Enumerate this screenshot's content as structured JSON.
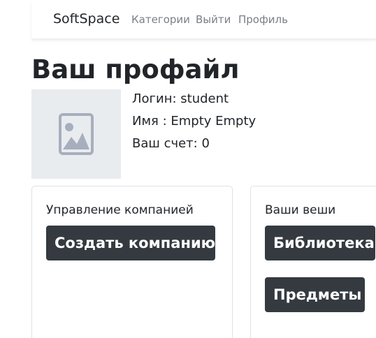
{
  "navbar": {
    "brand": "SoftSpace",
    "links": [
      "Категории",
      "Выйти",
      "Профиль"
    ]
  },
  "page": {
    "title": "Ваш профайл"
  },
  "profile": {
    "avatar_icon": "image-placeholder-icon",
    "login": "Логин: student",
    "name": "Имя : Empty Empty",
    "balance": "Ваш счет: 0"
  },
  "cards": {
    "company": {
      "title": "Управление компанией",
      "button": "Создать компанию"
    },
    "items": {
      "title": "Ваши веши",
      "buttons": [
        "Библиотека",
        "Предметы"
      ]
    }
  },
  "colors": {
    "button_bg": "#343a40",
    "placeholder_bg": "#e9ecef",
    "placeholder_icon": "#a7aebd"
  }
}
